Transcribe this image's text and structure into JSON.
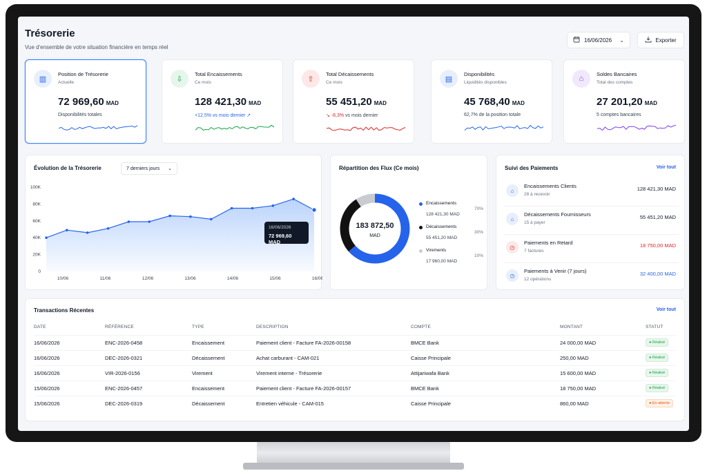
{
  "header": {
    "title": "Trésorerie",
    "subtitle": "Vue d'ensemble de votre situation financière en temps réel",
    "date": "16/06/2026",
    "export_label": "Exporter"
  },
  "kpis": [
    {
      "title": "Position de Trésorerie",
      "sub": "Actuelle",
      "value": "72 969,60",
      "currency": "MAD",
      "note_prefix": "",
      "note": "Disponibilités totales",
      "color": "#2563eb",
      "icon": "bar-chart-icon",
      "icon_bg": "#e8effc"
    },
    {
      "title": "Total Encaissements",
      "sub": "Ce mois",
      "value": "128 421,30",
      "currency": "MAD",
      "note_prefix": "+12,5% vs mois dernier ↗",
      "note": "",
      "color": "#16a34a",
      "icon": "money-in-icon",
      "icon_bg": "#e6f6ec"
    },
    {
      "title": "Total Décaissements",
      "sub": "Ce mois",
      "value": "55 451,20",
      "currency": "MAD",
      "note_prefix": "↘ -8,3%",
      "note": " vs mois dernier",
      "color": "#dc2626",
      "icon": "money-out-icon",
      "icon_bg": "#fde8e8"
    },
    {
      "title": "Disponibilités",
      "sub": "Liquidités disponibles",
      "value": "45 768,40",
      "currency": "MAD",
      "note_prefix": "",
      "note": "62,7% de la position totale",
      "color": "#2563eb",
      "icon": "wallet-icon",
      "icon_bg": "#e8effc"
    },
    {
      "title": "Soldes Bancaires",
      "sub": "Total des comptes",
      "value": "27 201,20",
      "currency": "MAD",
      "note_prefix": "",
      "note": "5 comptes bancaires",
      "color": "#7c3aed",
      "icon": "bank-icon",
      "icon_bg": "#f1e8fd"
    }
  ],
  "evolution": {
    "title": "Évolution de la Trésorerie",
    "range": "7 derniers jours",
    "tooltip_date": "16/06/2026",
    "tooltip_value": "72 969,60 MAD"
  },
  "chart_data": {
    "type": "area",
    "title": "Évolution de la Trésorerie",
    "x": [
      "10/06",
      "",
      "11/06",
      "",
      "12/06",
      "",
      "13/06",
      "",
      "14/06",
      "",
      "15/06",
      "",
      "16/06"
    ],
    "values": [
      40000,
      49000,
      46000,
      51000,
      59000,
      59000,
      66000,
      65000,
      62000,
      75000,
      75000,
      78000,
      86000,
      72969.6
    ],
    "x_ticks": [
      "10/06",
      "11/06",
      "12/06",
      "13/06",
      "14/06",
      "15/06",
      "16/06"
    ],
    "y_ticks": [
      "100K",
      "80K",
      "60K",
      "40K",
      "20K",
      "0"
    ],
    "ylim": [
      0,
      100000
    ],
    "color": "#2563eb"
  },
  "repartition": {
    "title": "Répartition des Flux (Ce mois)",
    "total": "183 872,50",
    "currency": "MAD",
    "items": [
      {
        "name": "Encaissements",
        "amount": "128 421,30 MAD",
        "pct": "70%",
        "value": 70,
        "color": "#2563eb"
      },
      {
        "name": "Décaissements",
        "amount": "55 451,20 MAD",
        "pct": "30%",
        "value": 30,
        "color": "#111111"
      },
      {
        "name": "Virements",
        "amount": "17 960,00 MAD",
        "pct": "10%",
        "value": 10,
        "color": "#c8cbd0"
      }
    ]
  },
  "payments": {
    "title": "Suivi des Paiements",
    "link": "Voir tout",
    "items": [
      {
        "name": "Encaissements Clients",
        "sub": "28 à recevoir",
        "amount": "128 421,30 MAD",
        "color": "#111827",
        "icon": "inbox-in-icon",
        "icon_bg": "#e8effc",
        "icon_color": "#2563eb"
      },
      {
        "name": "Décaissements Fournisseurs",
        "sub": "15 à payer",
        "amount": "55 451,20 MAD",
        "color": "#111827",
        "icon": "inbox-out-icon",
        "icon_bg": "#e8effc",
        "icon_color": "#2563eb"
      },
      {
        "name": "Paiements en Retard",
        "sub": "7 factures",
        "amount": "18 750,00 MAD",
        "color": "#dc2626",
        "icon": "alert-clock-icon",
        "icon_bg": "#fde8e8",
        "icon_color": "#dc2626"
      },
      {
        "name": "Paiements à Venir (7 jours)",
        "sub": "12 opérations",
        "amount": "32 400,00 MAD",
        "color": "#2563eb",
        "icon": "clock-icon",
        "icon_bg": "#e8effc",
        "icon_color": "#2563eb"
      }
    ]
  },
  "transactions": {
    "title": "Transactions Récentes",
    "link": "Voir tout",
    "columns": [
      "DATE",
      "RÉFÉRENCE",
      "TYPE",
      "DESCRIPTION",
      "COMPTE",
      "MONTANT",
      "STATUT"
    ],
    "rows": [
      {
        "date": "16/06/2026",
        "ref": "ENC-2026-0458",
        "type": "Encaissement",
        "desc": "Paiement client - Facture FA-2026-00158",
        "account": "BMCE Bank",
        "amount": "24 000,00 MAD",
        "status": "● Réalisé",
        "status_kind": "ok"
      },
      {
        "date": "16/06/2026",
        "ref": "DEC-2026-0321",
        "type": "Décaissement",
        "desc": "Achat carburant - CAM-021",
        "account": "Caisse Principale",
        "amount": "250,00 MAD",
        "status": "● Réalisé",
        "status_kind": "ok"
      },
      {
        "date": "16/06/2026",
        "ref": "VIR-2026-0156",
        "type": "Virement",
        "desc": "Virement interne - Trésorerie",
        "account": "Attijariwafa Bank",
        "amount": "15 600,00 MAD",
        "status": "● Réalisé",
        "status_kind": "ok"
      },
      {
        "date": "15/06/2026",
        "ref": "ENC-2026-0457",
        "type": "Encaissement",
        "desc": "Paiement client - Facture FA-2026-00157",
        "account": "BMCE Bank",
        "amount": "18 750,00 MAD",
        "status": "● Réalisé",
        "status_kind": "ok"
      },
      {
        "date": "15/06/2026",
        "ref": "DEC-2026-0319",
        "type": "Décaissement",
        "desc": "Entretien véhicule - CAM-015",
        "account": "Caisse Principale",
        "amount": "860,00 MAD",
        "status": "● En attente",
        "status_kind": "wait"
      }
    ]
  }
}
